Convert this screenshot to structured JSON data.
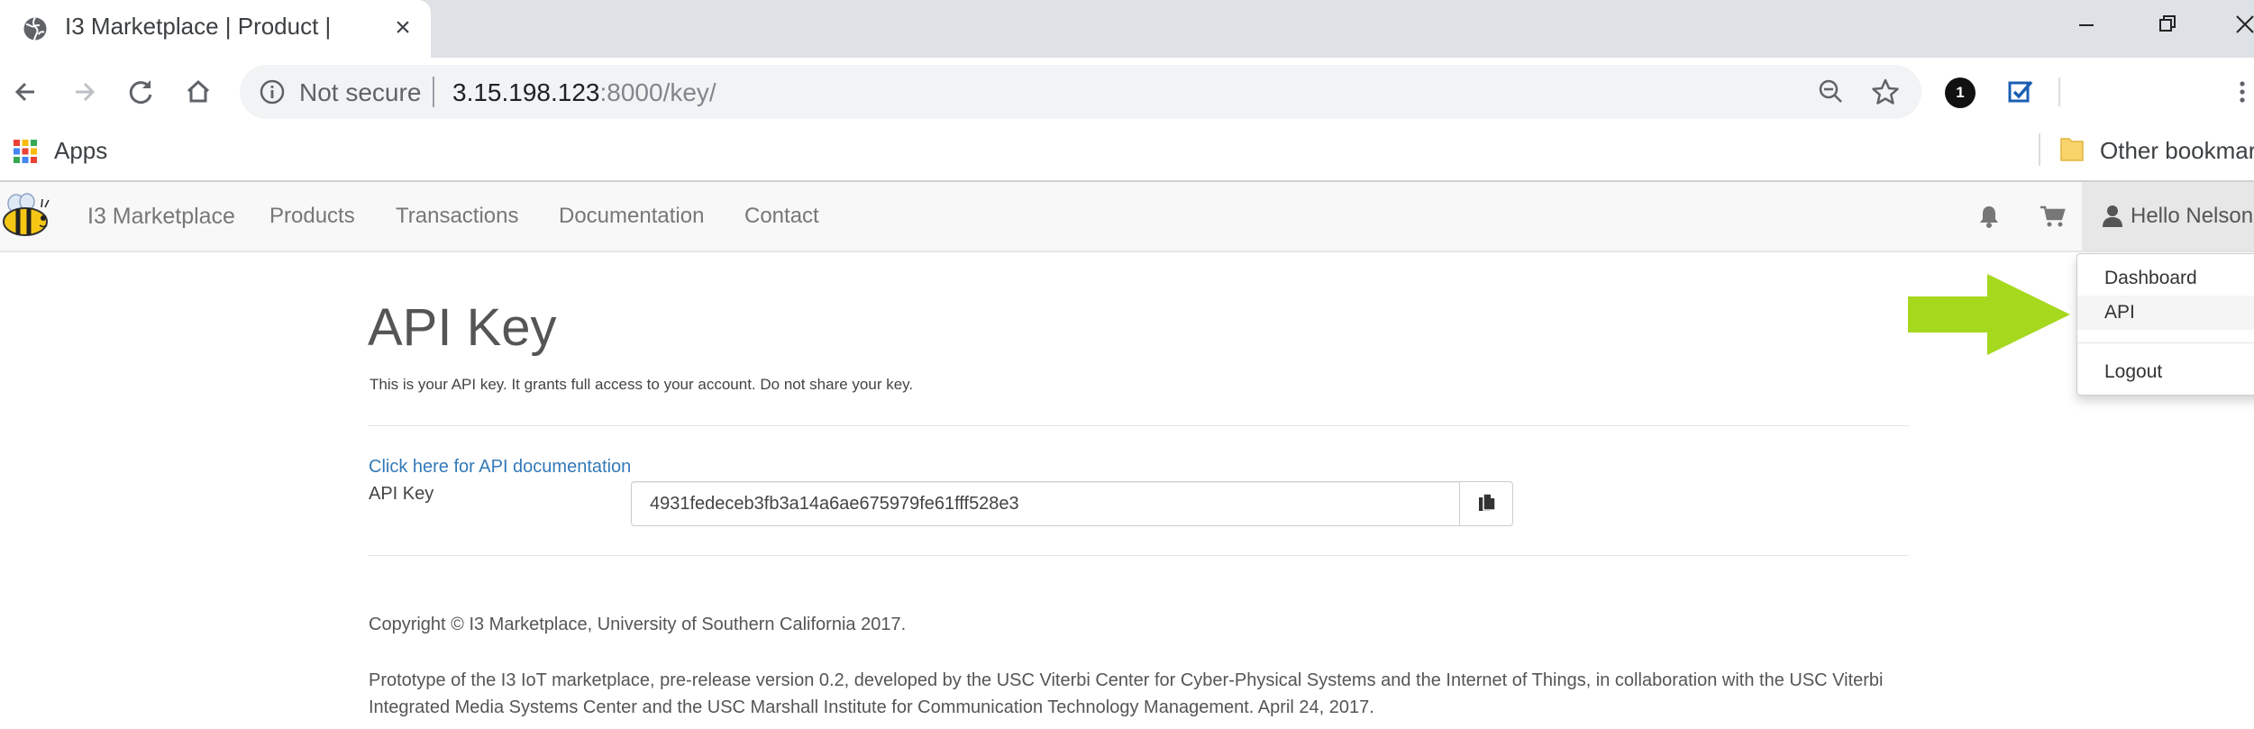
{
  "browser": {
    "tab_title": "I3 Marketplace | Product |",
    "security_label": "Not secure",
    "url_host": "3.15.198.123",
    "url_rest": ":8000/key/",
    "extension_badge": "1",
    "bookmarks": {
      "apps_label": "Apps",
      "other_label": "Other bookmarks"
    }
  },
  "navbar": {
    "brand": "I3 Marketplace",
    "links": [
      "Products",
      "Transactions",
      "Documentation",
      "Contact"
    ],
    "user_label": "Hello Nelson"
  },
  "dropdown": {
    "items": [
      "Dashboard",
      "API",
      "Logout"
    ],
    "highlighted": "API"
  },
  "annotation": {
    "arrow_color": "#a6d81e"
  },
  "main": {
    "title": "API Key",
    "description": "This is your API key. It grants full access to your account. Do not share your key.",
    "doc_link": "Click here for API documentation",
    "key_label": "API Key",
    "key_value": "4931fedeceb3fb3a14a6ae675979fe61fff528e3"
  },
  "footer": {
    "copyright": "Copyright © I3 Marketplace, University of Southern California 2017.",
    "prototype": "Prototype of the I3 IoT marketplace, pre-release version 0.2, developed by the USC Viterbi Center for Cyber-Physical Systems and the Internet of Things, in collaboration with the USC Viterbi Integrated Media Systems Center and the USC Marshall Institute for Communication Technology Management. April 24, 2017."
  },
  "colors": {
    "link": "#337ab7",
    "navbar_bg": "#f8f8f8",
    "tabstrip_bg": "#dee1e6"
  }
}
